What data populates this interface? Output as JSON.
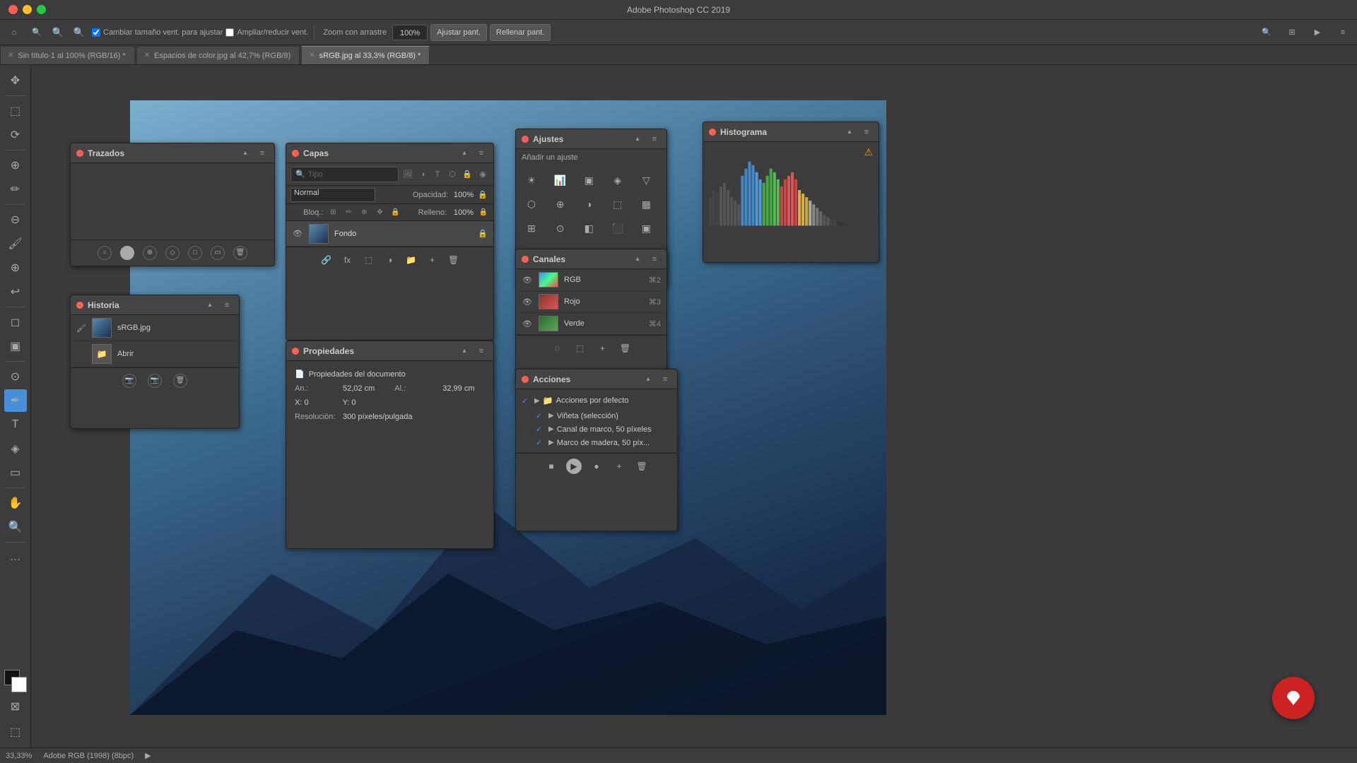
{
  "app": {
    "title": "Adobe Photoshop CC 2019"
  },
  "menu": {
    "zoom_label": "Zoom con arrastre",
    "zoom_value": "100%",
    "ajustar_pant": "Ajustar pant.",
    "rellenar_pant": "Rellenar pant.",
    "cambiar_tamano": "Cambiar tamaño vent. para ajustar",
    "ampliar_reducir": "Ampliar/reducir vent."
  },
  "tabs": [
    {
      "label": "Sin título-1 al 100% (RGB/16)",
      "active": false,
      "modified": true
    },
    {
      "label": "Espacios de color.jpg al 42,7% (RGB/8)",
      "active": false,
      "modified": false
    },
    {
      "label": "sRGB.jpg al 33,3% (RGB/8)",
      "active": true,
      "modified": true
    }
  ],
  "panels": {
    "trazados": {
      "title": "Trazados"
    },
    "historia": {
      "title": "Historia",
      "items": [
        {
          "name": "sRGB.jpg",
          "type": "photo"
        },
        {
          "name": "Abrir",
          "type": "folder"
        }
      ]
    },
    "capas": {
      "title": "Capas",
      "blend_mode": "Normal",
      "opacity_label": "Opacidad:",
      "opacity_value": "100%",
      "bloqueo_label": "Bloq.:",
      "relleno_label": "Relleno:",
      "relleno_value": "100%",
      "layers": [
        {
          "name": "Fondo",
          "visible": true,
          "locked": true
        }
      ]
    },
    "propiedades": {
      "title": "Propiedades",
      "doc_section": "Propiedades del documento",
      "width_label": "An.:",
      "width_value": "52,02 cm",
      "height_label": "Al.:",
      "height_value": "32,99 cm",
      "x_label": "X: 0",
      "y_label": "Y: 0",
      "resolucion_label": "Resolución:",
      "resolucion_value": "300 píxeles/pulgada"
    },
    "ajustes": {
      "title": "Ajustes",
      "subtitle": "Añadir un ajuste"
    },
    "canales": {
      "title": "Canales",
      "channels": [
        {
          "name": "RGB",
          "shortcut": "⌘2",
          "type": "rgb"
        },
        {
          "name": "Rojo",
          "shortcut": "⌘3",
          "type": "red"
        },
        {
          "name": "Verde",
          "shortcut": "⌘4",
          "type": "green"
        }
      ]
    },
    "acciones": {
      "title": "Acciones",
      "groups": [
        {
          "name": "Acciones por defecto",
          "expanded": true,
          "items": [
            {
              "name": "Viñeta (selección)"
            },
            {
              "name": "Canal de marco, 50 píxeles"
            },
            {
              "name": "Marco de madera, 50 píx..."
            }
          ]
        }
      ]
    },
    "histograma": {
      "title": "Histograma"
    }
  },
  "status": {
    "zoom": "33,33%",
    "color_profile": "Adobe RGB (1998) (8bpc)"
  }
}
